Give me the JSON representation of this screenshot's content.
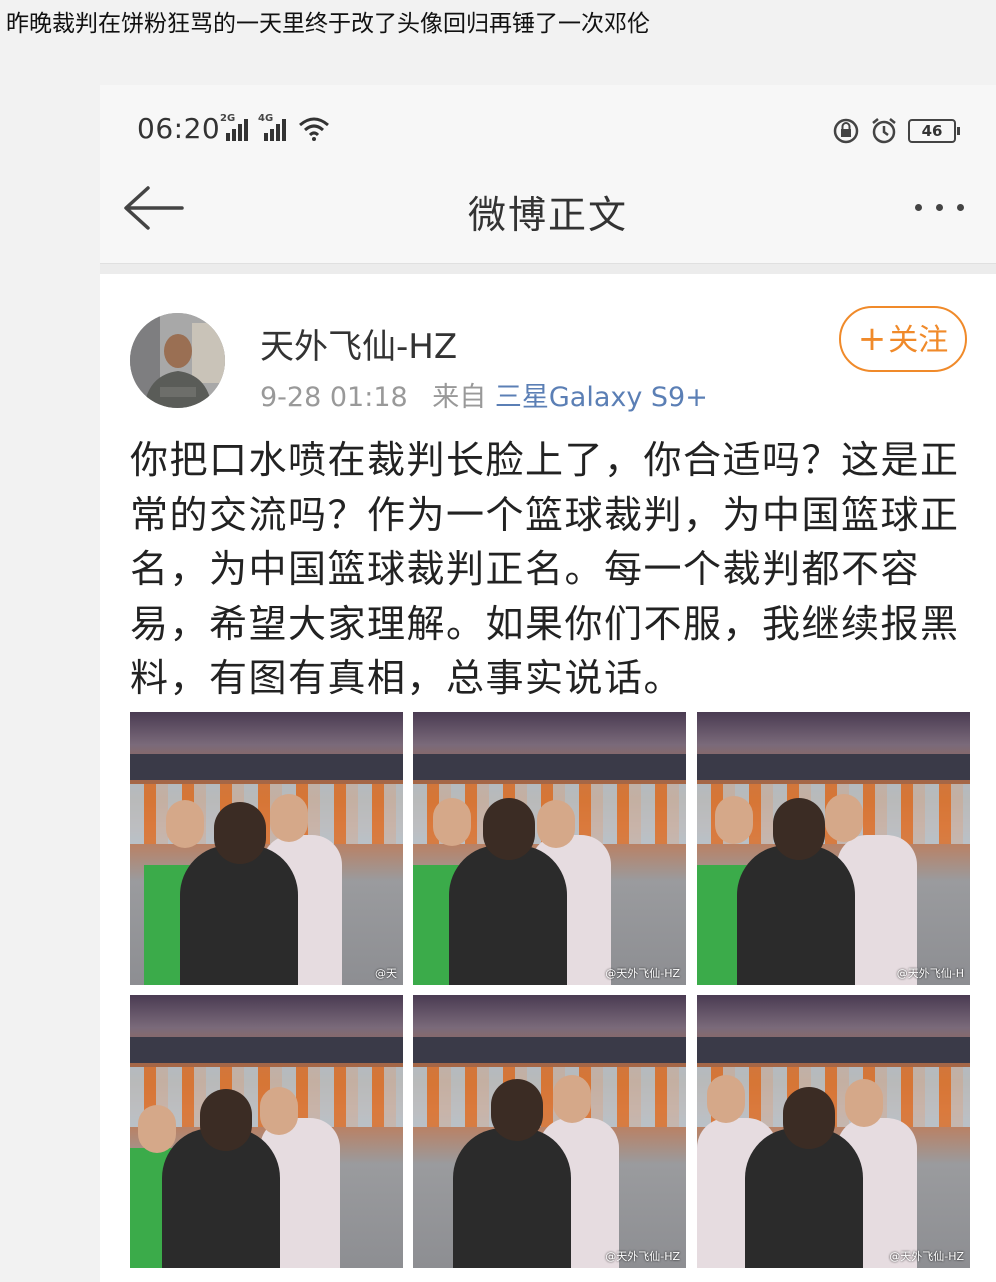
{
  "caption": "昨晚裁判在饼粉狂骂的一天里终于改了头像回归再锤了一次邓伦",
  "statusbar": {
    "time": "06:20",
    "sim1": "2G",
    "sim2": "4G",
    "battery": "46",
    "icons": [
      "signal-icon",
      "wifi-icon",
      "lock-rotation-icon",
      "alarm-icon",
      "battery-icon"
    ]
  },
  "nav": {
    "title": "微博正文",
    "back_icon": "back-arrow-icon",
    "more_icon": "more-dots-icon"
  },
  "post": {
    "username": "天外飞仙-HZ",
    "date": "9-28 01:18",
    "source_prefix": "来自",
    "source": "三星Galaxy S9+",
    "follow_label": "关注",
    "follow_icon": "plus-icon",
    "text": "你把口水喷在裁判长脸上了，你合适吗？这是正常的交流吗？作为一个篮球裁判，为中国篮球正名，为中国篮球裁判正名。每一个裁判都不容易，希望大家理解。如果你们不服，我继续报黑料，有图有真相，总事实说话。",
    "photos": [
      {
        "watermark": "@天"
      },
      {
        "watermark": "@天外飞仙-HZ"
      },
      {
        "watermark": "@天外飞仙-H"
      },
      {
        "watermark": ""
      },
      {
        "watermark": "@天外飞仙-HZ"
      },
      {
        "watermark": "@天外飞仙-HZ"
      }
    ]
  },
  "colors": {
    "accent": "#f08a2a",
    "link": "#5b7fb5",
    "meta": "#999999"
  }
}
